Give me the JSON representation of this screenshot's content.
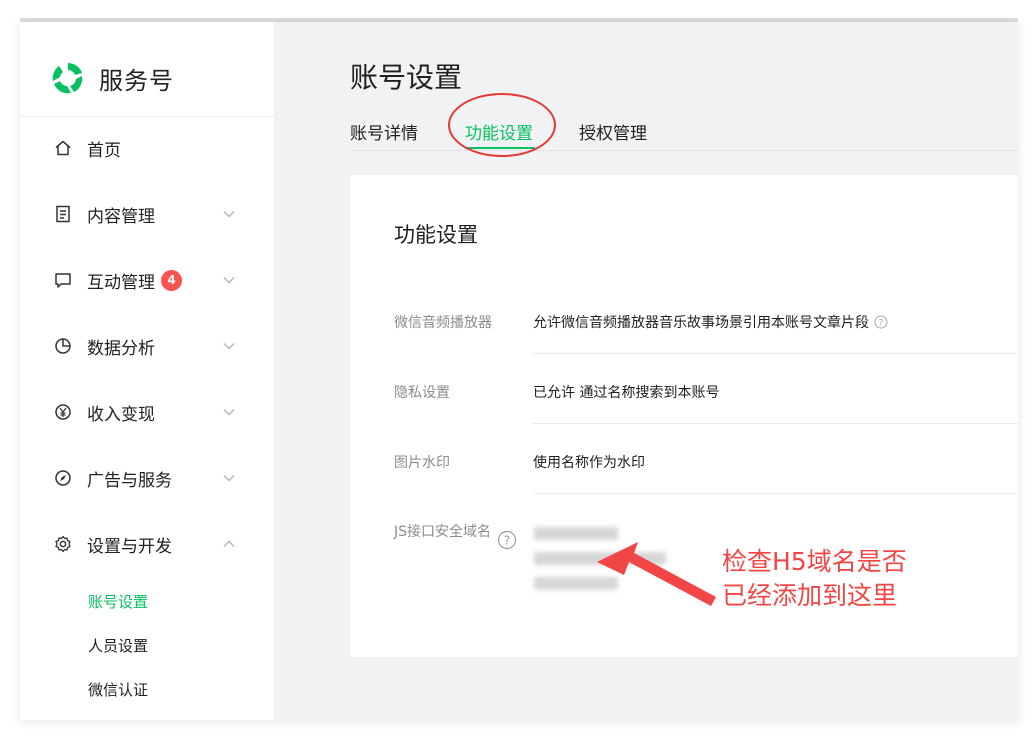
{
  "app": {
    "name": "服务号"
  },
  "sidebar": {
    "items": [
      {
        "label": "首页",
        "icon": "home-icon"
      },
      {
        "label": "内容管理",
        "icon": "document-icon"
      },
      {
        "label": "互动管理",
        "icon": "message-icon",
        "badge": "4"
      },
      {
        "label": "数据分析",
        "icon": "pie-chart-icon"
      },
      {
        "label": "收入变现",
        "icon": "yen-icon"
      },
      {
        "label": "广告与服务",
        "icon": "compass-icon"
      },
      {
        "label": "设置与开发",
        "icon": "gear-icon"
      }
    ],
    "sub_items": [
      {
        "label": "账号设置",
        "active": true
      },
      {
        "label": "人员设置"
      },
      {
        "label": "微信认证"
      }
    ]
  },
  "main": {
    "title": "账号设置",
    "tabs": [
      {
        "label": "账号详情"
      },
      {
        "label": "功能设置",
        "active": true
      },
      {
        "label": "授权管理"
      }
    ]
  },
  "card": {
    "title": "功能设置",
    "rows": [
      {
        "label": "微信音频播放器",
        "value": "允许微信音频播放器音乐故事场景引用本账号文章片段"
      },
      {
        "label": "隐私设置",
        "value": "已允许 通过名称搜索到本账号"
      },
      {
        "label": "图片水印",
        "value": "使用名称作为水印"
      },
      {
        "label": "JS接口安全域名"
      }
    ]
  },
  "annotation": {
    "text_line1": "检查H5域名是否",
    "text_line2": "已经添加到这里"
  },
  "colors": {
    "accent": "#07c160",
    "badge": "#fa5151",
    "annotation": "#f24545"
  }
}
